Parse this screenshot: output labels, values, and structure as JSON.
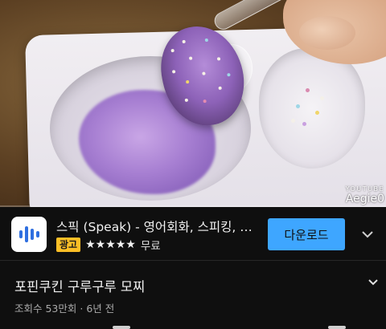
{
  "video": {
    "watermark_top": "YOUTUBE",
    "watermark_name": "Aegie0",
    "progress_fraction": 0.0
  },
  "ad": {
    "app_title": "스픽 (Speak) - 영어회화, 스피킹, 발음",
    "badge": "광고",
    "rating_stars": 5,
    "stars_text": "★★★★★",
    "price": "무료",
    "cta_label": "다운로드",
    "icon": "speak-app-icon",
    "accent_color": "#3ea6ff",
    "badge_color": "#fcbf26"
  },
  "info": {
    "title": "포핀쿠킨 구루구루 모찌",
    "views": "조회수 53만회",
    "separator": "·",
    "age": "6년 전"
  },
  "icons": {
    "ad_expand": "chevron-down-icon",
    "title_expand": "chevron-down-icon"
  }
}
